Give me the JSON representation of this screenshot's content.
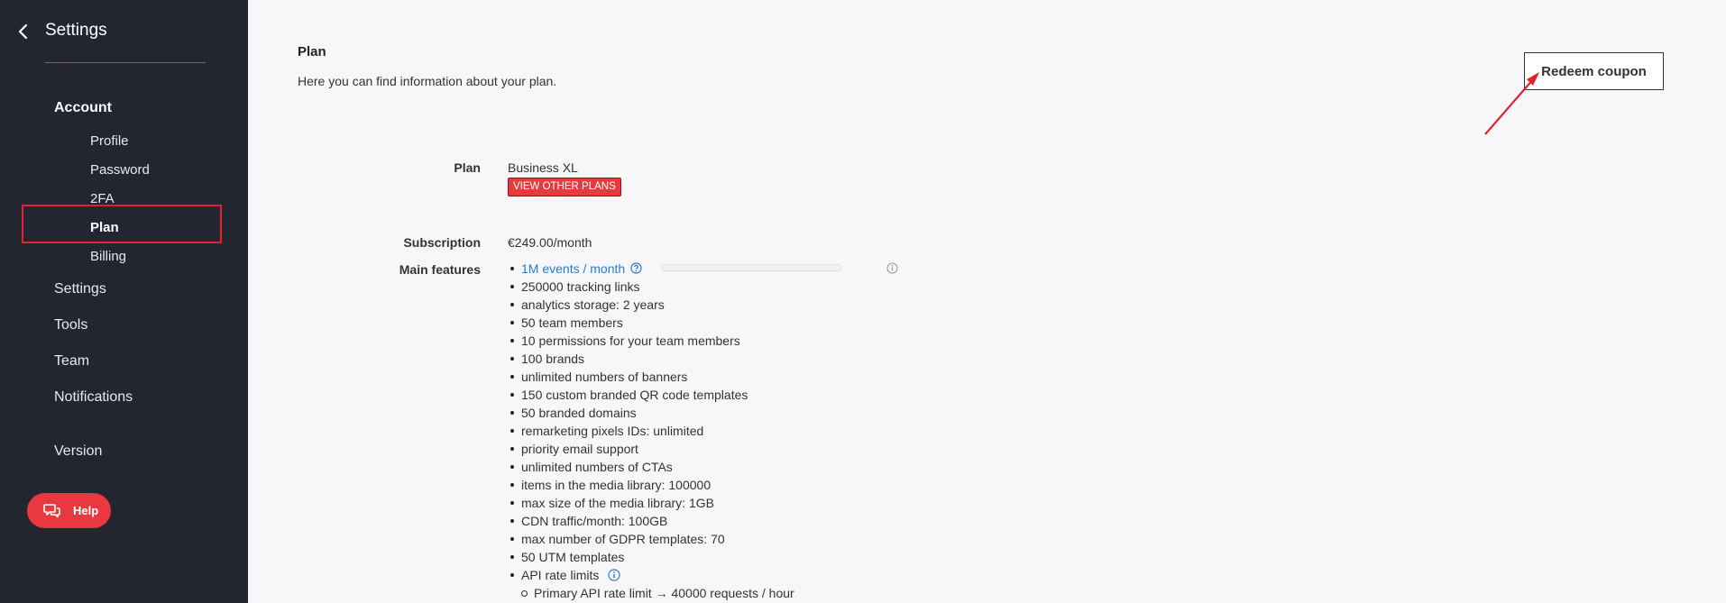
{
  "sidebar": {
    "title": "Settings",
    "section": "Account",
    "account_items": [
      "Profile",
      "Password",
      "2FA",
      "Plan",
      "Billing"
    ],
    "items": [
      "Settings",
      "Tools",
      "Team",
      "Notifications",
      "Version"
    ],
    "help_label": "Help",
    "accent_color": "#e9383f"
  },
  "main": {
    "title": "Plan",
    "description": "Here you can find information about your plan.",
    "redeem_label": "Redeem coupon",
    "plan_label": "Plan",
    "plan_value": "Business XL",
    "view_plans_label": "VIEW OTHER PLANS",
    "subscription_label": "Subscription",
    "subscription_value": "€249.00/month",
    "features_label": "Main features",
    "events_link": "1M events / month",
    "features": [
      "250000 tracking links",
      "analytics storage: 2 years",
      "50 team members",
      "10 permissions for your team members",
      "100 brands",
      "unlimited numbers of banners",
      "150 custom branded QR code templates",
      "50 branded domains",
      "remarketing pixels IDs: unlimited",
      "priority email support",
      "unlimited numbers of CTAs",
      "items in the media library: 100000",
      "max size of the media library: 1GB",
      "CDN traffic/month: 100GB",
      "max number of GDPR templates: 70",
      "50 UTM templates"
    ],
    "api_label": "API rate limits",
    "api_sub": "Primary API rate limit → 40000 requests / hour"
  }
}
